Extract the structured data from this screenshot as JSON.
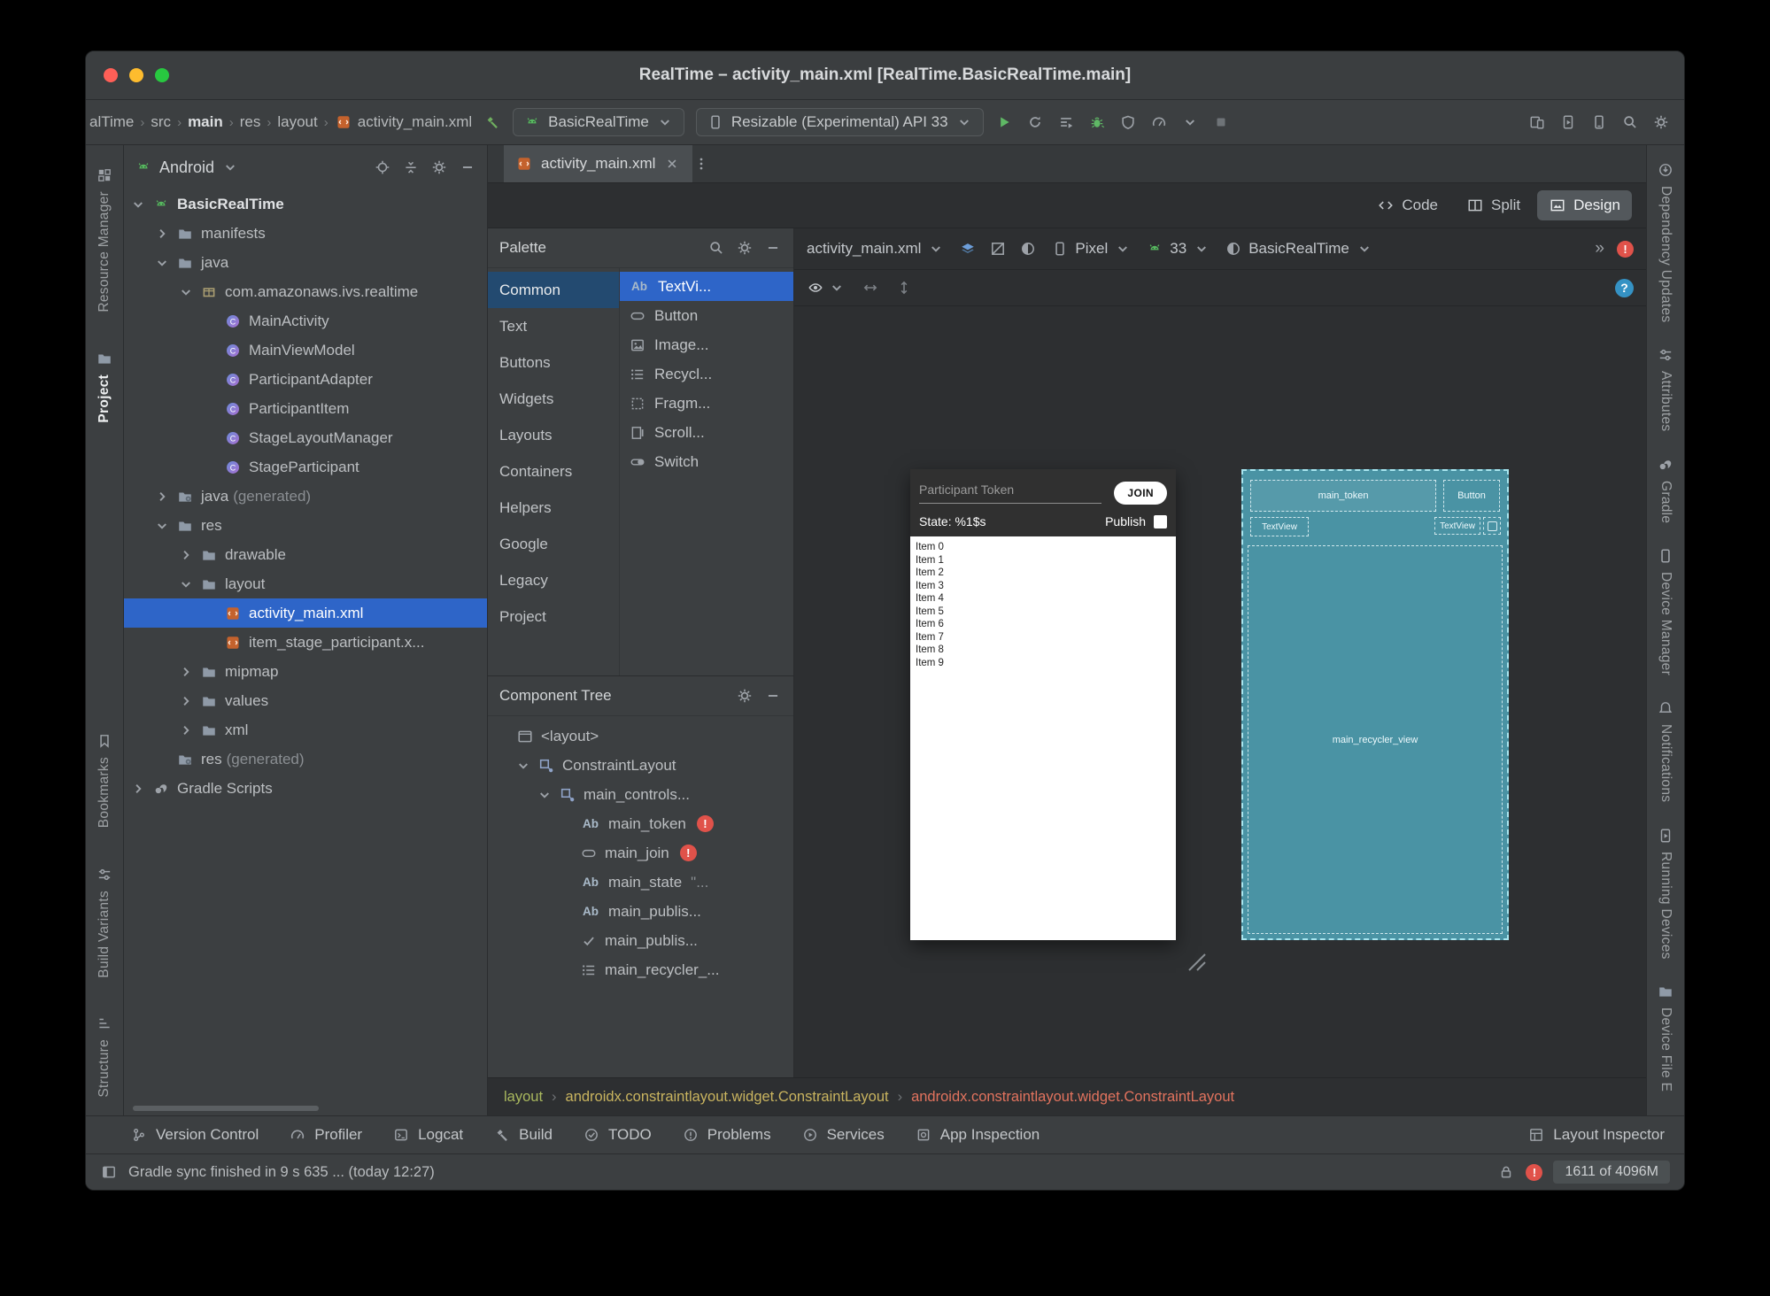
{
  "window": {
    "title": "RealTime – activity_main.xml [RealTime.BasicRealTime.main]"
  },
  "colors": {
    "selection": "#2e65c8",
    "error": "#e0524a",
    "blueprint_fill": "#4a93a4",
    "blueprint_border": "#a8e6f0",
    "android_green": "#57b85f",
    "join_button_bg": "#ffffff"
  },
  "nav": {
    "breadcrumbs": [
      "alTime",
      "src",
      "main",
      "res",
      "layout",
      "activity_main.xml"
    ],
    "run_config": "BasicRealTime",
    "device": "Resizable (Experimental) API 33",
    "run_icons": [
      "run",
      "apply-changes",
      "run-tasks",
      "debug",
      "coverage",
      "profiler",
      "chev-down",
      "stop"
    ],
    "right_icons": [
      "device-mirroring",
      "running-devices",
      "device-manager",
      "search",
      "settings"
    ]
  },
  "left_strip": {
    "top": [
      {
        "label": "Resource Manager",
        "icon": "resource-manager"
      },
      {
        "label": "Project",
        "icon": "folder",
        "active": true
      }
    ],
    "bottom": [
      {
        "label": "Bookmarks",
        "icon": "bookmark"
      },
      {
        "label": "Build Variants",
        "icon": "sliders"
      },
      {
        "label": "Structure",
        "icon": "structure"
      }
    ]
  },
  "right_strip": [
    {
      "label": "Dependency Updates",
      "icon": "dependency"
    },
    {
      "label": "Attributes",
      "icon": "sliders"
    },
    {
      "label": "Gradle",
      "icon": "gradle"
    },
    {
      "label": "Device Manager",
      "icon": "phone"
    },
    {
      "label": "Notifications",
      "icon": "bell"
    },
    {
      "label": "Running Devices",
      "icon": "running-devices"
    },
    {
      "label": "Device File E",
      "icon": "folder"
    }
  ],
  "project_panel": {
    "view": "Android",
    "header_icons": [
      "crosshair",
      "collapse",
      "gear",
      "minus"
    ],
    "tree": [
      {
        "label": "BasicRealTime",
        "level": 0,
        "chev": "down",
        "icon": "android",
        "bold": true
      },
      {
        "label": "manifests",
        "level": 1,
        "chev": "right",
        "icon": "folder"
      },
      {
        "label": "java",
        "level": 1,
        "chev": "down",
        "icon": "folder"
      },
      {
        "label": "com.amazonaws.ivs.realtime",
        "level": 2,
        "chev": "down",
        "icon": "package"
      },
      {
        "label": "MainActivity",
        "level": 3,
        "icon": "kclass"
      },
      {
        "label": "MainViewModel",
        "level": 3,
        "icon": "kclass"
      },
      {
        "label": "ParticipantAdapter",
        "level": 3,
        "icon": "kclass"
      },
      {
        "label": "ParticipantItem",
        "level": 3,
        "icon": "kclass"
      },
      {
        "label": "StageLayoutManager",
        "level": 3,
        "icon": "kclass"
      },
      {
        "label": "StageParticipant",
        "level": 3,
        "icon": "kclass"
      },
      {
        "label": "java",
        "suffix": "(generated)",
        "level": 1,
        "chev": "right",
        "icon": "folder-gen"
      },
      {
        "label": "res",
        "level": 1,
        "chev": "down",
        "icon": "folder"
      },
      {
        "label": "drawable",
        "level": 2,
        "chev": "right",
        "icon": "folder"
      },
      {
        "label": "layout",
        "level": 2,
        "chev": "down",
        "icon": "folder"
      },
      {
        "label": "activity_main.xml",
        "level": 3,
        "icon": "xmlfile",
        "selected": true
      },
      {
        "label": "item_stage_participant.x...",
        "level": 3,
        "icon": "xmlfile"
      },
      {
        "label": "mipmap",
        "level": 2,
        "chev": "right",
        "icon": "folder"
      },
      {
        "label": "values",
        "level": 2,
        "chev": "right",
        "icon": "folder"
      },
      {
        "label": "xml",
        "level": 2,
        "chev": "right",
        "icon": "folder"
      },
      {
        "label": "res",
        "suffix": "(generated)",
        "level": 1,
        "icon": "folder-gen"
      },
      {
        "label": "Gradle Scripts",
        "level": 0,
        "chev": "right",
        "icon": "gradle"
      }
    ]
  },
  "editor": {
    "tab": "activity_main.xml",
    "modes": [
      {
        "label": "Code",
        "icon": "code"
      },
      {
        "label": "Split",
        "icon": "split"
      },
      {
        "label": "Design",
        "icon": "design",
        "active": true
      }
    ]
  },
  "palette": {
    "title": "Palette",
    "header_icons": [
      "search",
      "gear",
      "minus"
    ],
    "categories": [
      "Common",
      "Text",
      "Buttons",
      "Widgets",
      "Layouts",
      "Containers",
      "Helpers",
      "Google",
      "Legacy",
      "Project"
    ],
    "selected_category": "Common",
    "components": [
      {
        "label": "TextVi...",
        "icon": "ab",
        "selected": true
      },
      {
        "label": "Button",
        "icon": "buttonw"
      },
      {
        "label": "Image...",
        "icon": "image"
      },
      {
        "label": "Recycl...",
        "icon": "recycler"
      },
      {
        "label": "Fragm...",
        "icon": "fragment"
      },
      {
        "label": "Scroll...",
        "icon": "scroll"
      },
      {
        "label": "Switch",
        "icon": "switch"
      }
    ]
  },
  "component_tree": {
    "title": "Component Tree",
    "header_icons": [
      "gear",
      "minus"
    ],
    "items": [
      {
        "label": "<layout>",
        "level": 0,
        "icon": "layoutroot"
      },
      {
        "label": "ConstraintLayout",
        "level": 1,
        "chev": "down",
        "icon": "constraint"
      },
      {
        "label": "main_controls...",
        "level": 2,
        "chev": "down",
        "icon": "constraint"
      },
      {
        "label": "main_token",
        "level": 3,
        "icon": "ab",
        "error": true
      },
      {
        "label": "main_join",
        "level": 3,
        "icon": "buttonw",
        "error": true
      },
      {
        "label": "main_state",
        "level": 3,
        "icon": "ab",
        "suffix": "\"..."
      },
      {
        "label": "main_publis...",
        "level": 3,
        "icon": "ab"
      },
      {
        "label": "main_publis...",
        "level": 3,
        "icon": "check"
      },
      {
        "label": "main_recycler_...",
        "level": 3,
        "icon": "recycler"
      }
    ]
  },
  "surface": {
    "file": "activity_main.xml",
    "device": "Pixel",
    "api": "33",
    "theme": "BasicRealTime",
    "overflow": "»"
  },
  "preview": {
    "design": {
      "token_hint": "Participant Token",
      "join_label": "JOIN",
      "state_text": "State: %1$s",
      "publish_label": "Publish",
      "items": [
        "Item 0",
        "Item 1",
        "Item 2",
        "Item 3",
        "Item 4",
        "Item 5",
        "Item 6",
        "Item 7",
        "Item 8",
        "Item 9"
      ]
    },
    "blueprint": {
      "token": "main_token",
      "button": "Button",
      "state": "TextView",
      "publish": "TextView",
      "recycler": "main_recycler_view"
    }
  },
  "xml_breadcrumbs": [
    {
      "label": "layout",
      "color": "#a9b85e"
    },
    {
      "label": "androidx.constraintlayout.widget.ConstraintLayout",
      "color": "#c9b45f"
    },
    {
      "label": "androidx.constraintlayout.widget.ConstraintLayout",
      "color": "#e2735e"
    }
  ],
  "bottom_bar": {
    "items": [
      {
        "label": "Version Control",
        "icon": "branch"
      },
      {
        "label": "Profiler",
        "icon": "profiler"
      },
      {
        "label": "Logcat",
        "icon": "logcat"
      },
      {
        "label": "Build",
        "icon": "build"
      },
      {
        "label": "TODO",
        "icon": "todo"
      },
      {
        "label": "Problems",
        "icon": "problems"
      },
      {
        "label": "Services",
        "icon": "services"
      },
      {
        "label": "App Inspection",
        "icon": "app-inspection"
      }
    ],
    "right": {
      "label": "Layout Inspector",
      "icon": "layout-inspector"
    }
  },
  "status_bar": {
    "message": "Gradle sync finished in 9 s 635 ... (today 12:27)",
    "memory": "1611 of 4096M"
  }
}
